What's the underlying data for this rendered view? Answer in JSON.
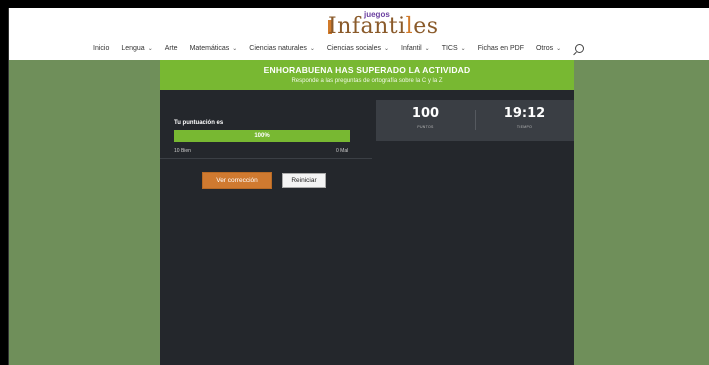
{
  "logo": {
    "small": "juegos",
    "main_left": "Infanti",
    "main_hl": "l",
    "main_right": "es"
  },
  "nav": {
    "items": [
      {
        "label": "Inicio",
        "dropdown": false
      },
      {
        "label": "Lengua",
        "dropdown": true
      },
      {
        "label": "Arte",
        "dropdown": false
      },
      {
        "label": "Matemáticas",
        "dropdown": true
      },
      {
        "label": "Ciencias naturales",
        "dropdown": true
      },
      {
        "label": "Ciencias sociales",
        "dropdown": true
      },
      {
        "label": "Infantil",
        "dropdown": true
      },
      {
        "label": "TICS",
        "dropdown": true
      },
      {
        "label": "Fichas en PDF",
        "dropdown": false
      },
      {
        "label": "Otros",
        "dropdown": true
      }
    ],
    "search_icon": "search-icon"
  },
  "banner": {
    "title": "ENHORABUENA HAS SUPERADO LA ACTIVIDAD",
    "subtitle": "Responde a las preguntas de ortografía sobre la C y la Z"
  },
  "score": {
    "label": "Tu puntuación es",
    "progress_text": "100%",
    "progress_value": 100,
    "bien": "10 Bien",
    "mal": "0 Mal"
  },
  "buttons": {
    "correction": "Ver corrección",
    "restart": "Reiniciar"
  },
  "stats": {
    "points_value": "100",
    "points_label": "PUNTOS",
    "time_value": "19:12",
    "time_label": "TIEMPO"
  },
  "colors": {
    "green": "#78b832",
    "background_green": "#6f8f5a",
    "panel": "#24272c",
    "orange_button": "#d07a30"
  }
}
